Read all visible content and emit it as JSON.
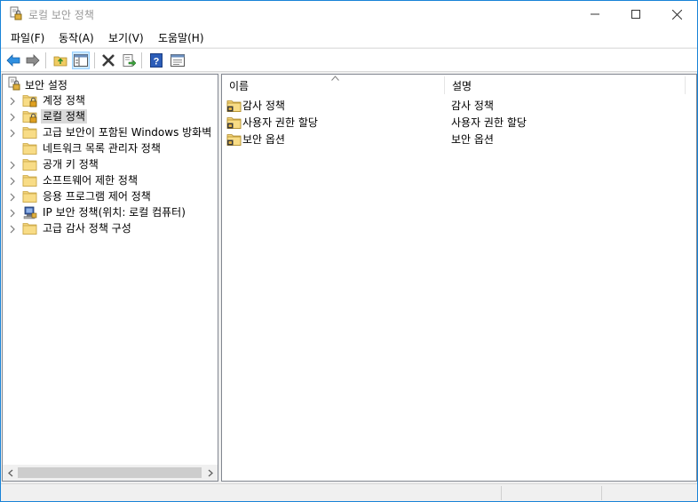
{
  "window": {
    "title": "로컬 보안 정책",
    "accent_color": "#1883d7"
  },
  "menu": {
    "file": "파일(F)",
    "action": "동작(A)",
    "view": "보기(V)",
    "help": "도움말(H)"
  },
  "toolbar": {
    "buttons": [
      "back-icon",
      "forward-icon",
      "up-folder-icon",
      "show-hide-tree-icon",
      "delete-icon",
      "export-list-icon",
      "help-icon",
      "properties-icon"
    ]
  },
  "tree": {
    "root_label": "보안 설정",
    "nodes": [
      {
        "label": "계정 정책",
        "expandable": true,
        "icon": "folder-lock-icon"
      },
      {
        "label": "로컬 정책",
        "expandable": true,
        "icon": "folder-lock-icon",
        "selected": true
      },
      {
        "label": "고급 보안이 포함된 Windows 방화벽",
        "expandable": true,
        "icon": "folder-icon"
      },
      {
        "label": "네트워크 목록 관리자 정책",
        "expandable": false,
        "icon": "folder-icon"
      },
      {
        "label": "공개 키 정책",
        "expandable": true,
        "icon": "folder-icon"
      },
      {
        "label": "소프트웨어 제한 정책",
        "expandable": true,
        "icon": "folder-icon"
      },
      {
        "label": "응용 프로그램 제어 정책",
        "expandable": true,
        "icon": "folder-icon"
      },
      {
        "label": "IP 보안 정책(위치: 로컬 컴퓨터)",
        "expandable": true,
        "icon": "ip-security-icon"
      },
      {
        "label": "고급 감사 정책 구성",
        "expandable": true,
        "icon": "folder-icon"
      }
    ]
  },
  "list": {
    "col_name": "이름",
    "col_desc": "설명",
    "rows": [
      {
        "name": "감사 정책",
        "desc": "감사 정책"
      },
      {
        "name": "사용자 권한 할당",
        "desc": "사용자 권한 할당"
      },
      {
        "name": "보안 옵션",
        "desc": "보안 옵션"
      }
    ]
  }
}
